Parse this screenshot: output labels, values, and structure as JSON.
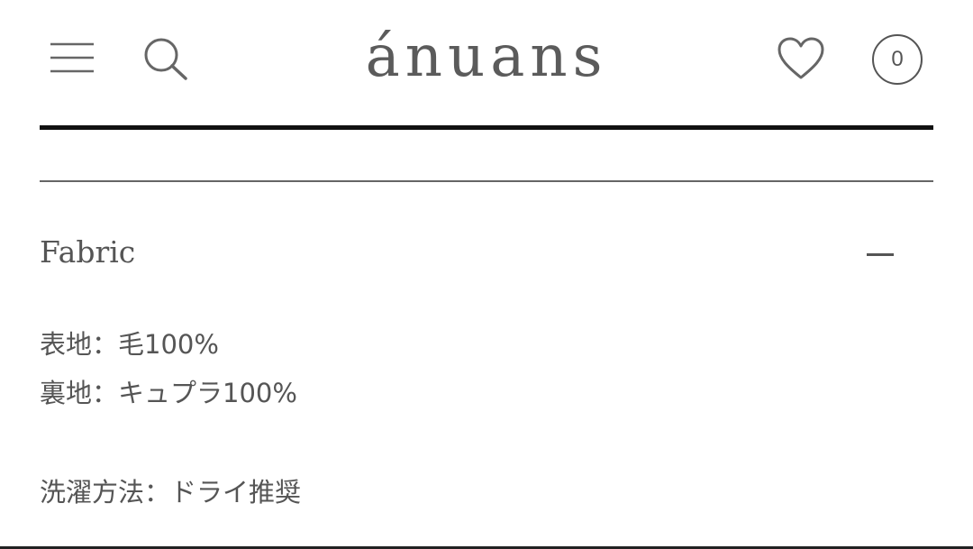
{
  "header": {
    "logo": "ánuans",
    "cart_count": "0",
    "icons": {
      "menu": "hamburger-menu-icon",
      "search": "search-icon",
      "wishlist": "heart-icon",
      "cart": "cart-count-badge"
    }
  },
  "accordion": {
    "title": "Fabric",
    "toggle_icon": "minus-icon",
    "content": {
      "outer_fabric": "表地：毛100%",
      "lining": "裏地：キュプラ100%",
      "care": "洗濯方法：ドライ推奨"
    }
  },
  "colors": {
    "text": "#555555",
    "rule_dark": "#111111",
    "rule_light": "#666666",
    "background": "#ffffff"
  }
}
